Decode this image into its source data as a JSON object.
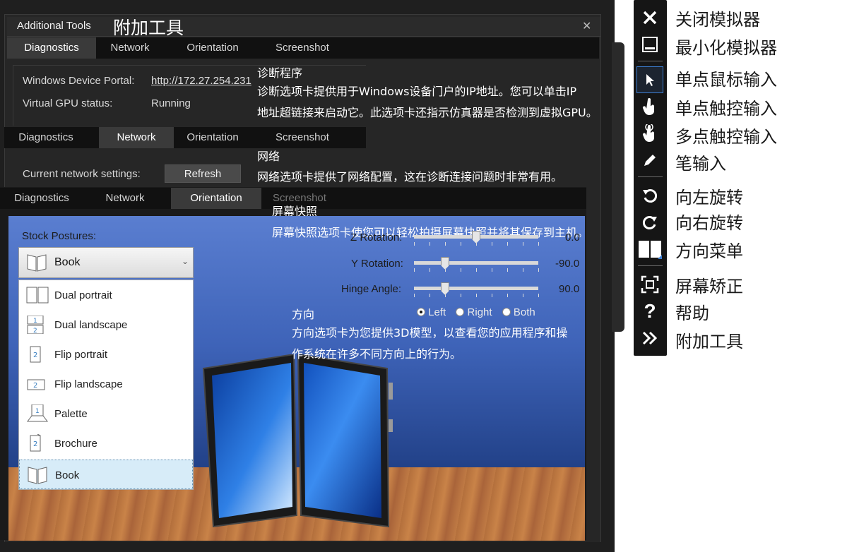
{
  "window": {
    "title": "Additional Tools",
    "title_callout": "附加工具"
  },
  "tabs": [
    "Diagnostics",
    "Network",
    "Orientation",
    "Screenshot"
  ],
  "diagnostics": {
    "device_portal_label": "Windows Device Portal:",
    "device_portal_url": "http://172.27.254.231",
    "gpu_label": "Virtual GPU status:",
    "gpu_value": "Running",
    "callout_title": "诊断程序",
    "callout_line1": "诊断选项卡提供用于Windows设备门户的IP地址。您可以单击IP",
    "callout_line2": "地址超链接来启动它。此选项卡还指示仿真器是否检测到虚拟GPU。"
  },
  "network": {
    "settings_label": "Current network settings:",
    "refresh_label": "Refresh",
    "callout_title": "网络",
    "callout_text": "网络选项卡提供了网络配置，这在诊断连接问题时非常有用。"
  },
  "screenshot": {
    "callout_title": "屏幕快照",
    "callout_text": "屏幕快照选项卡使您可以轻松拍摄屏幕快照并将其保存到主机。"
  },
  "orientation": {
    "stock_postures_label": "Stock Postures:",
    "selected_posture": "Book",
    "postures": [
      "Dual portrait",
      "Dual landscape",
      "Flip portrait",
      "Flip landscape",
      "Palette",
      "Brochure",
      "Book"
    ],
    "z_rotation_label": "Z Rotation:",
    "z_rotation_value": "0.0",
    "z_rotation_fraction": 0.5,
    "y_rotation_label": "Y Rotation:",
    "y_rotation_value": "-90.0",
    "y_rotation_fraction": 0.25,
    "hinge_label": "Hinge Angle:",
    "hinge_value": "90.0",
    "hinge_fraction": 0.25,
    "radio_options": [
      "Left",
      "Right",
      "Both"
    ],
    "radio_selected": "Left",
    "callout_title": "方向",
    "callout_line1": "方向选项卡为您提供3D模型，以查看您的应用程序和操",
    "callout_line2": "作系统在许多不同方向上的行为。"
  },
  "toolbar": {
    "items": [
      {
        "icon": "close-icon",
        "label": "关闭模拟器"
      },
      {
        "icon": "minimize-icon",
        "label": "最小化模拟器"
      },
      {
        "icon": "cursor-icon",
        "label": "单点鼠标输入"
      },
      {
        "icon": "touch-icon",
        "label": "单点触控输入"
      },
      {
        "icon": "multi-touch-icon",
        "label": "多点触控输入"
      },
      {
        "icon": "pen-icon",
        "label": "笔输入"
      },
      {
        "icon": "rotate-left-icon",
        "label": "向左旋转"
      },
      {
        "icon": "rotate-right-icon",
        "label": "向右旋转"
      },
      {
        "icon": "posture-menu-icon",
        "label": "方向菜单"
      },
      {
        "icon": "fit-screen-icon",
        "label": "屏幕矫正"
      },
      {
        "icon": "help-icon",
        "label": "帮助"
      },
      {
        "icon": "more-tools-icon",
        "label": "附加工具"
      }
    ]
  },
  "colors": {
    "accent": "#3d7fd3",
    "selection": "#d7ecf8"
  }
}
